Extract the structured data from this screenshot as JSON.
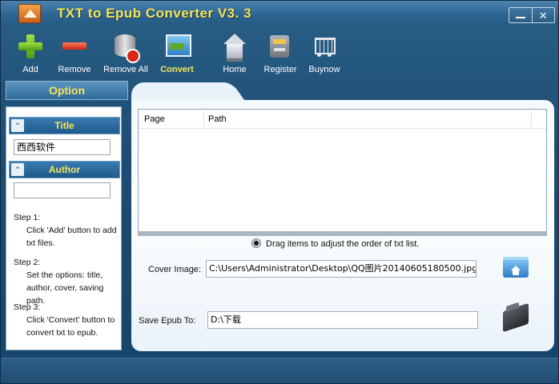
{
  "window": {
    "title": "TXT to Epub Converter V3. 3"
  },
  "toolbar": {
    "items": [
      {
        "id": "add",
        "label": "Add",
        "icon": "add-plus-icon"
      },
      {
        "id": "remove",
        "label": "Remove",
        "icon": "remove-minus-icon"
      },
      {
        "id": "remove_all",
        "label": "Remove All",
        "icon": "database-remove-icon"
      },
      {
        "id": "convert",
        "label": "Convert",
        "icon": "convert-picture-icon",
        "active": true
      },
      {
        "id": "home",
        "label": "Home",
        "icon": "home-icon"
      },
      {
        "id": "register",
        "label": "Register",
        "icon": "cash-register-icon"
      },
      {
        "id": "buynow",
        "label": "Buynow",
        "icon": "shopping-cart-icon"
      }
    ]
  },
  "option": {
    "header": "Option",
    "title_section": {
      "label": "Title",
      "value": "西西软件"
    },
    "author_section": {
      "label": "Author",
      "value": ""
    },
    "steps": [
      {
        "heading": "Step 1:",
        "text": "Click 'Add' button to add txt files."
      },
      {
        "heading": "Step 2:",
        "text": "Set the options: title, author, cover, saving path."
      },
      {
        "heading": "Step 3:",
        "text": "Click 'Convert' button to convert txt to epub."
      }
    ]
  },
  "file_list": {
    "columns": [
      "Page",
      "Path"
    ],
    "rows": [],
    "hint": "Drag items to  adjust the order of txt list."
  },
  "cover": {
    "label": "Cover Image:",
    "value": "C:\\Users\\Administrator\\Desktop\\QQ图片20140605180500.jpg"
  },
  "save": {
    "label": "Save  Epub  To:",
    "value": "D:\\下载"
  },
  "colors": {
    "accent_yellow": "#f7e35a",
    "frame_blue": "#1d4d74"
  }
}
